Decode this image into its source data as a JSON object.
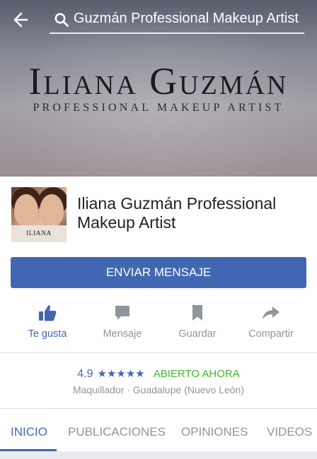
{
  "header": {
    "search_text": "Guzmán Professional Makeup Artist"
  },
  "cover": {
    "brand_name": "Iliana Guzmán",
    "brand_subtitle": "PROFESSIONAL MAKEUP ARTIST"
  },
  "profile": {
    "page_name": "Iliana Guzmán Professional Makeup Artist",
    "avatar_caption": "ILIANA GUZMÁN"
  },
  "send_button": {
    "label": "ENVIAR MENSAJE"
  },
  "actions": [
    {
      "label": "Te gusta",
      "icon": "thumbs-up-icon",
      "active": true
    },
    {
      "label": "Mensaje",
      "icon": "message-icon",
      "active": false
    },
    {
      "label": "Guardar",
      "icon": "bookmark-icon",
      "active": false
    },
    {
      "label": "Compartir",
      "icon": "share-icon",
      "active": false
    }
  ],
  "info": {
    "rating": "4.9",
    "stars": "★★★★★",
    "status": "ABIERTO AHORA",
    "category_location": "Maquillador · Guadalupe (Nuevo León)"
  },
  "tabs": [
    {
      "label": "INICIO",
      "active": true
    },
    {
      "label": "PUBLICACIONES",
      "active": false
    },
    {
      "label": "OPINIONES",
      "active": false
    },
    {
      "label": "VIDEOS",
      "active": false
    }
  ],
  "colors": {
    "accent": "#4267b2",
    "open_status": "#42b72a",
    "muted_text": "#90949c"
  }
}
